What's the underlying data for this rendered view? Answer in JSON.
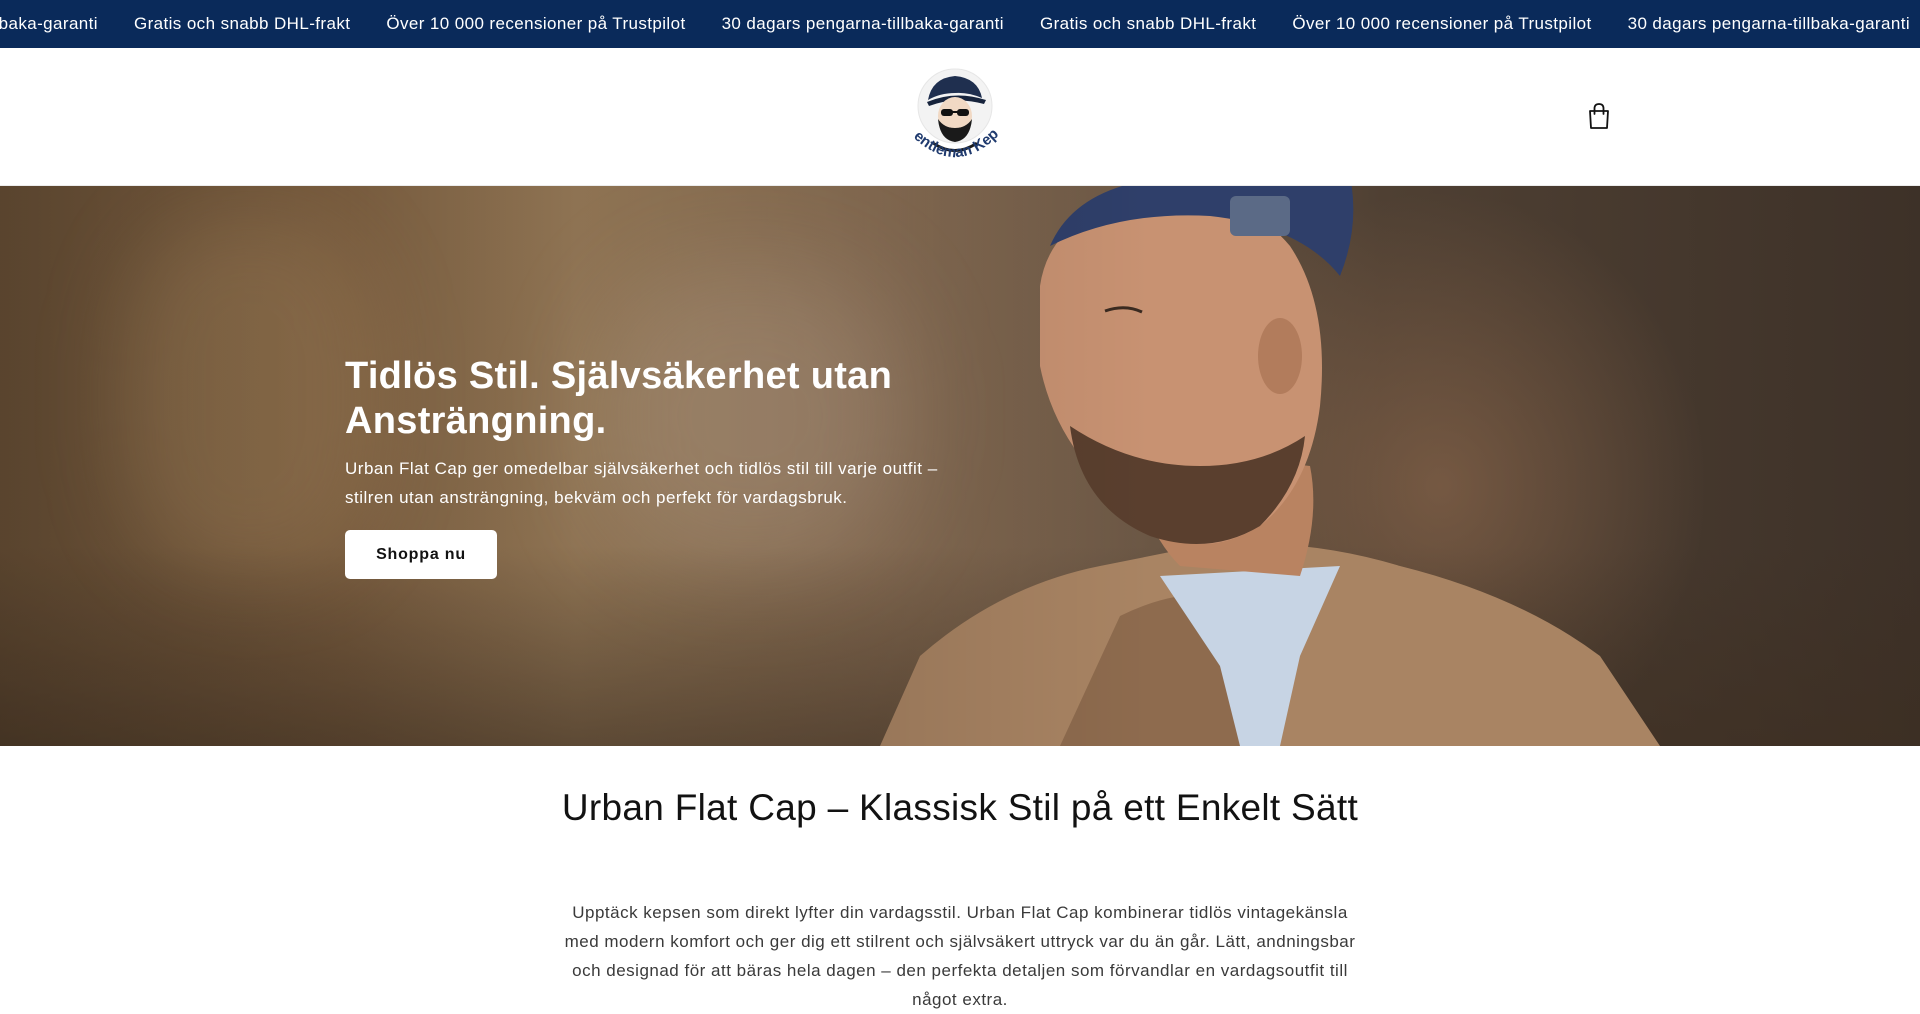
{
  "announcement_bar": {
    "items": [
      {
        "glyph": "",
        "text": "tillbaka-garanti"
      },
      {
        "glyph": "",
        "text": "Gratis och snabb DHL-frakt"
      },
      {
        "glyph": "",
        "text": "Över 10 000 recensioner på Trustpilot"
      },
      {
        "glyph": "",
        "text": "30 dagars pengarna-tillbaka-garanti"
      },
      {
        "glyph": "",
        "text": "Gratis och snabb DHL-frakt"
      },
      {
        "glyph": "",
        "text": "Över 10 000 recensioner på Trustpilot"
      },
      {
        "glyph": "",
        "text": "30 dagars pengarna-tillbaka-garanti"
      }
    ],
    "background": "#0a2a5a"
  },
  "header": {
    "logo_text": "Gentleman Keps",
    "cart_icon": "shopping-bag-icon"
  },
  "hero": {
    "title": "Tidlös Stil. Självsäkerhet utan Ansträngning.",
    "text": "Urban Flat Cap ger omedelbar självsäkerhet och tidlös stil till varje outfit – stilren utan ansträngning, bekväm och perfekt för vardagsbruk.",
    "button_label": "Shoppa nu"
  },
  "intro": {
    "title": "Urban Flat Cap – Klassisk Stil på ett Enkelt Sätt",
    "text": "Upptäck kepsen som direkt lyfter din vardagsstil. Urban Flat Cap kombinerar tidlös vintagekänsla med modern komfort och ger dig ett stilrent och självsäkert uttryck var du än går. Lätt, andningsbar och designad för att bäras hela dagen – den perfekta detaljen som förvandlar en vardagsoutfit till något extra."
  },
  "colors": {
    "brand_navy": "#0a2a5a",
    "text_dark": "#121212",
    "button_bg": "#ffffff"
  }
}
